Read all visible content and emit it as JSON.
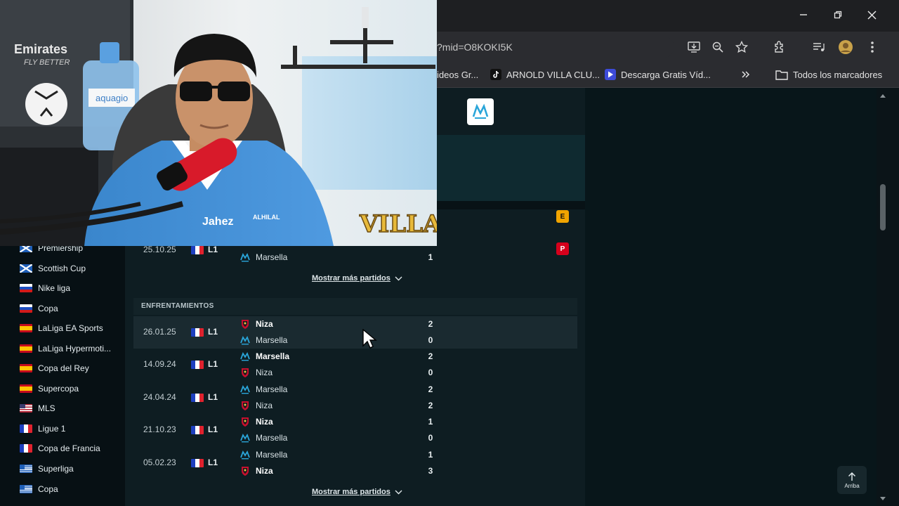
{
  "browser": {
    "url": "?mid=O8KOKI5K",
    "bookmarks": [
      {
        "label": "ideos Gr..."
      },
      {
        "label": "ARNOLD VILLA CLU..."
      },
      {
        "label": "Descarga Gratis Víd..."
      }
    ],
    "all_bookmarks_label": "Todos los marcadores",
    "overflow_label": "»"
  },
  "webcam": {
    "overlay_text": "VILLA",
    "wall_text": "Emirates",
    "wall_subtext": "FLY BETTER",
    "bottle_label": "aquagio",
    "shirt_text": "Jahez",
    "crest_text": "ALHILAL"
  },
  "sidebar": {
    "items": [
      {
        "label": "Premiership",
        "flag": "scotland"
      },
      {
        "label": "Scottish Cup",
        "flag": "scotland"
      },
      {
        "label": "Nike liga",
        "flag": "slovenia"
      },
      {
        "label": "Copa",
        "flag": "slovenia"
      },
      {
        "label": "LaLiga EA Sports",
        "flag": "spain"
      },
      {
        "label": "LaLiga Hypermoti...",
        "flag": "spain"
      },
      {
        "label": "Copa del Rey",
        "flag": "spain"
      },
      {
        "label": "Supercopa",
        "flag": "spain"
      },
      {
        "label": "MLS",
        "flag": "usa"
      },
      {
        "label": "Ligue 1",
        "flag": "france"
      },
      {
        "label": "Copa de Francia",
        "flag": "france"
      },
      {
        "label": "Superliga",
        "flag": "greece"
      },
      {
        "label": "Copa",
        "flag": "greece"
      }
    ]
  },
  "badges": {
    "e": "E",
    "p": "P"
  },
  "last_match": {
    "date": "25.10.25",
    "league": "L1",
    "team": "Marsella",
    "score": "1"
  },
  "show_more_label": "Mostrar más partidos",
  "h2h": {
    "title": "ENFRENTAMIENTOS",
    "rows": [
      {
        "date": "26.01.25",
        "league": "L1",
        "home": "Niza",
        "away": "Marsella",
        "home_score": "2",
        "away_score": "0"
      },
      {
        "date": "14.09.24",
        "league": "L1",
        "home": "Marsella",
        "away": "Niza",
        "home_score": "2",
        "away_score": "0"
      },
      {
        "date": "24.04.24",
        "league": "L1",
        "home": "Marsella",
        "away": "Niza",
        "home_score": "2",
        "away_score": "2"
      },
      {
        "date": "21.10.23",
        "league": "L1",
        "home": "Niza",
        "away": "Marsella",
        "home_score": "1",
        "away_score": "0"
      },
      {
        "date": "05.02.23",
        "league": "L1",
        "home": "Marsella",
        "away": "Niza",
        "home_score": "1",
        "away_score": "3"
      }
    ]
  },
  "scroll_top_label": "Arriba",
  "colors": {
    "accent_yellow": "#f0a400",
    "accent_red": "#d6001c",
    "bg_dark": "#0c1a1e"
  }
}
